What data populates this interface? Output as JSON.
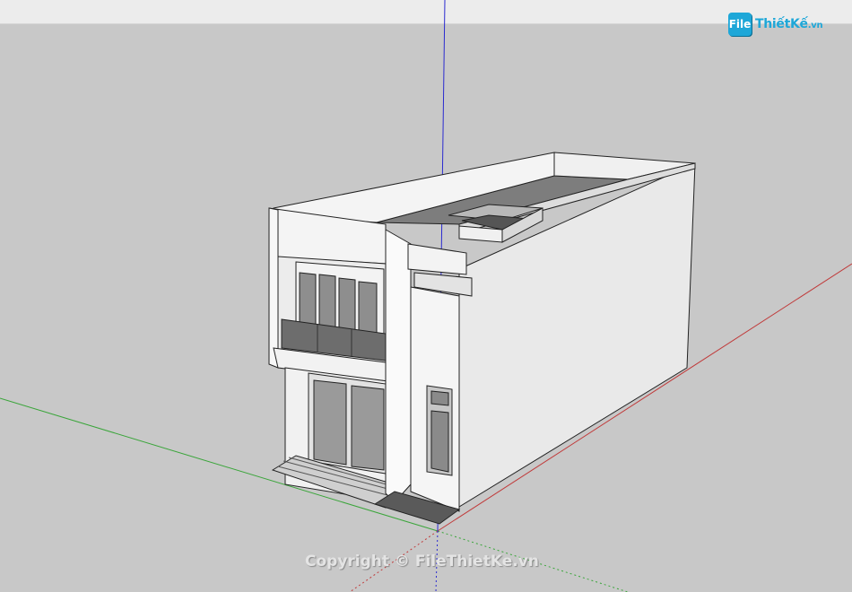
{
  "watermark": {
    "badge_text": "File",
    "brand_text": "ThiếtKế",
    "brand_suffix": ".vn"
  },
  "copyright": {
    "text": "Copyright © FileThietKe.vn"
  },
  "colors": {
    "background": "#c8c8c8",
    "topbar": "#ececec",
    "axis_red": "#c03a3a",
    "axis_green": "#3aa53a",
    "axis_blue": "#2a2ad0",
    "brand": "#1ea7d8"
  }
}
